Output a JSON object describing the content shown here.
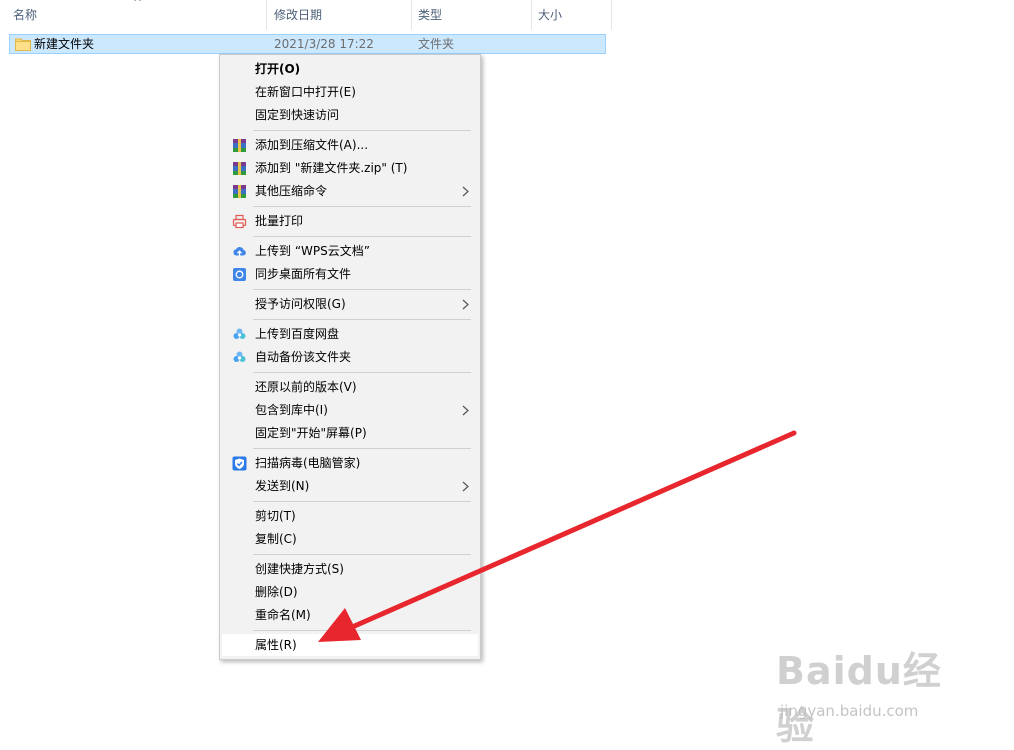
{
  "columns": {
    "name": "名称",
    "modified": "修改日期",
    "type": "类型",
    "size": "大小"
  },
  "file": {
    "name": "新建文件夹",
    "modified": "2021/3/28 17:22",
    "type": "文件夹",
    "size": ""
  },
  "menu": {
    "open": "打开(O)",
    "open_new_window": "在新窗口中打开(E)",
    "pin_quick_access": "固定到快速访问",
    "add_to_archive": "添加到压缩文件(A)...",
    "add_to_zip": "添加到 \"新建文件夹.zip\" (T)",
    "more_compress": "其他压缩命令",
    "batch_print": "批量打印",
    "upload_wps": "上传到 “WPS云文档”",
    "sync_desktop": "同步桌面所有文件",
    "grant_access": "授予访问权限(G)",
    "upload_baidu": "上传到百度网盘",
    "auto_backup": "自动备份该文件夹",
    "restore_versions": "还原以前的版本(V)",
    "include_library": "包含到库中(I)",
    "pin_start": "固定到\"开始\"屏幕(P)",
    "scan_virus": "扫描病毒(电脑管家)",
    "send_to": "发送到(N)",
    "cut": "剪切(T)",
    "copy": "复制(C)",
    "create_shortcut": "创建快捷方式(S)",
    "delete": "删除(D)",
    "rename": "重命名(M)",
    "properties": "属性(R)"
  },
  "watermark": {
    "brand": "Baidu经验",
    "url": "jingyan.baidu.com"
  },
  "colors": {
    "selection": "#cce8ff",
    "menu_bg": "#f2f2f2",
    "arrow": "#e8262d",
    "header_text": "#4c607a"
  }
}
